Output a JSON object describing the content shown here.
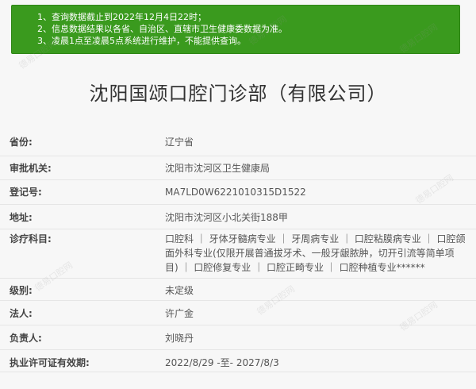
{
  "notice": {
    "items": [
      "1、查询数据截止到2022年12月4日22时；",
      "2、信息数据结果以各省、自治区、直辖市卫生健康委数据为准。",
      "3、凌晨1点至凌晨5点系统进行维护，不能提供查询。"
    ]
  },
  "title": "沈阳国颂口腔门诊部（有限公司）",
  "rows": [
    {
      "label": "省份:",
      "value": "辽宁省"
    },
    {
      "label": "审批机关:",
      "value": "沈阳市沈河区卫生健康局"
    },
    {
      "label": "登记号:",
      "value": "MA7LD0W6221010315D1522"
    },
    {
      "label": "地址:",
      "value": "沈阳市沈河区小北关街188甲"
    },
    {
      "label": "诊疗科目:",
      "value": "口腔科 ｜ 牙体牙髓病专业 ｜ 牙周病专业 ｜ 口腔粘膜病专业 ｜ 口腔颌面外科专业(仅限开展普通拔牙术、一般牙龈脓肿，切开引流等简单项目) ｜ 口腔修复专业 ｜ 口腔正畸专业 ｜ 口腔种植专业******"
    },
    {
      "label": "级别:",
      "value": "未定级"
    },
    {
      "label": "法人:",
      "value": "许广金"
    },
    {
      "label": "负责人:",
      "value": "刘晓丹"
    },
    {
      "label": "执业许可证有效期:",
      "value": "2022/8/29 -至- 2027/8/3"
    }
  ],
  "watermark": "德易口腔网"
}
